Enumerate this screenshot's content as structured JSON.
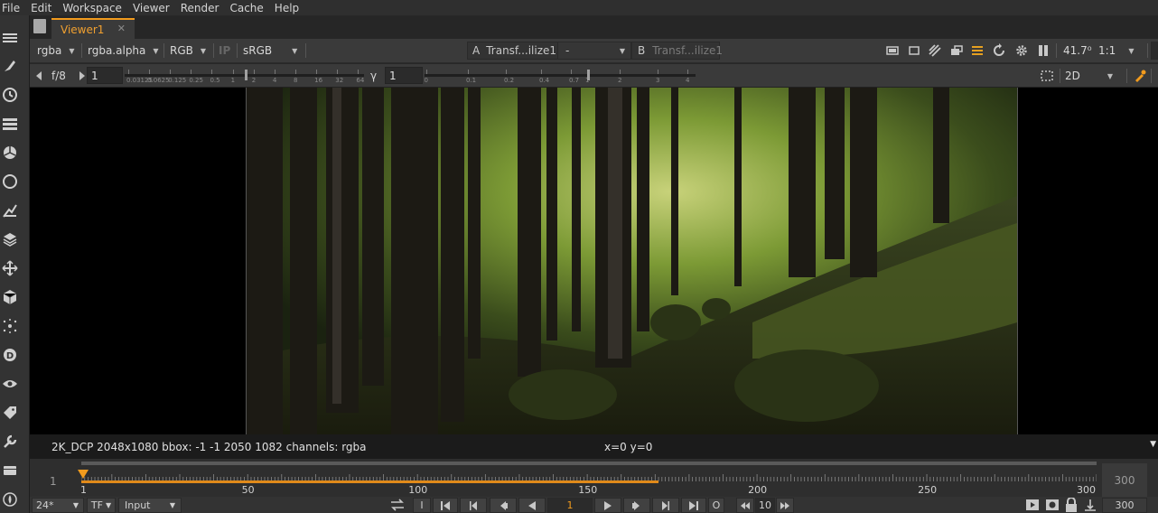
{
  "menu": [
    "File",
    "Edit",
    "Workspace",
    "Viewer",
    "Render",
    "Cache",
    "Help"
  ],
  "tab": {
    "label": "Viewer1",
    "close": "✕"
  },
  "toolbar1": {
    "layer": "rgba",
    "channel": "rgba.alpha",
    "display": "RGB",
    "ip": "IP",
    "colorspace": "sRGB",
    "a_label": "A",
    "a_input": "Transf...ilize1",
    "compare_mode": "-",
    "b_label": "B",
    "b_input": "Transf...ilize1",
    "zoom_value": "41.7⁰",
    "ratio": "1:1"
  },
  "toolbar2": {
    "fstop": "f/8",
    "gain_value": "1",
    "gamma_label": "γ",
    "gamma_value": "1",
    "gain_scale": [
      "0.03125",
      "0.0625",
      "0.125",
      "0.25",
      "0.5",
      "1",
      "2",
      "4",
      "8",
      "16",
      "32",
      "64"
    ],
    "gamma_scale": [
      "0",
      "0.1",
      "0.2",
      "0.4",
      "0.7",
      "1",
      "2",
      "3",
      "4"
    ],
    "view_mode": "2D"
  },
  "info": {
    "format": "2K_DCP 2048x1080  bbox: -1 -1 2050 1082 channels: rgba",
    "coords": "x=0 y=0"
  },
  "timeline": {
    "start": "1",
    "end": "300",
    "labels": [
      "1",
      "50",
      "100",
      "150",
      "200",
      "250",
      "300"
    ],
    "in_point": 1,
    "out_point": 300,
    "current_frame": 1,
    "cached_range_end": 171
  },
  "controls": {
    "fps": "24*",
    "tf": "TF",
    "mode": "Input",
    "frame_field": "1",
    "skip_value": "10",
    "end_frame": "300",
    "in_label": "I",
    "out_label": "O"
  },
  "colors": {
    "accent": "#f29b1d",
    "range": "#e08a1a",
    "background": "#282828"
  }
}
